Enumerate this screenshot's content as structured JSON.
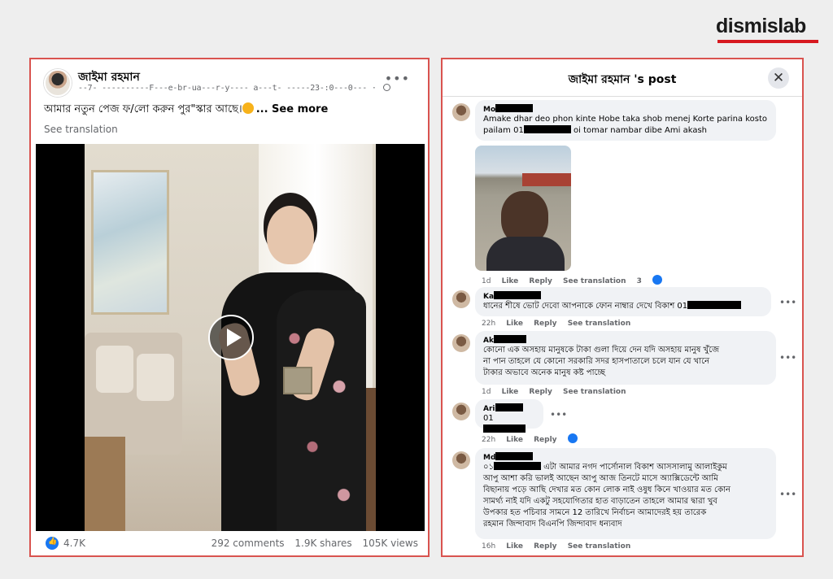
{
  "brand": {
    "logo_text": "dismislab",
    "accent": "#d71920"
  },
  "post": {
    "author": "জাইমা রহমান",
    "meta": "--7- ----------F---e-br-ua---r-y---- a---t- -----23-:0---0--- ·",
    "text": "আমার নতুন পেজ ফ/লো করুন পুর\"স্কার আছে।",
    "see_more": "... See more",
    "see_translation": "See translation",
    "reaction_count": "4.7K",
    "comments": "292 comments",
    "shares": "1.9K shares",
    "views": "105K views",
    "more_icon": "more-dots-icon",
    "play_icon": "play-icon"
  },
  "comments_panel": {
    "title": "জাইমা রহমান 's post",
    "close_label": "✕",
    "comments": [
      {
        "name": "Mo",
        "text_a": "Amake dhar deo phon kinte Hobe taka shob menej Korte parina kosto",
        "text_b": "pailam 01",
        "text_c": " oi tomar nambar dibe Ami akash",
        "time": "1d",
        "like": "Like",
        "reply": "Reply",
        "translation": "See translation",
        "reactions": "3"
      },
      {
        "name": "Ka",
        "text": "ধানের শীষে ভোট দেবো আপনাকে ফোন নাম্বার দেখে বিকাশ 01",
        "time": "22h",
        "like": "Like",
        "reply": "Reply",
        "translation": "See translation"
      },
      {
        "name": "Ak",
        "text_a": "কোনো এক অসহায় মানুষকে টাকা গুলা দিয়ে দেন যদি অসহায় মানুষ খুঁজে",
        "text_b": "না পান তাহলে যে কোনো সরকারি সদর হাসপাতালে চলে যান যে খানে",
        "text_c": "টাকার অভাবে অনেক মানুষ কষ্ট পাচ্ছে",
        "time": "1d",
        "like": "Like",
        "reply": "Reply",
        "translation": "See translation"
      },
      {
        "name": "Ari",
        "text": "01",
        "time": "22h",
        "like": "Like",
        "reply": "Reply"
      },
      {
        "name": "Md",
        "line1_a": "০১",
        "line1_b": " এটা আমার নগদ পার্সোনাল বিকাশ আসসালামু আলাইকুম",
        "line2": "আপু আশা করি ভালই আছেন আপু আজ তিনটে মাসে অ্যাক্সিডেন্টে আমি",
        "line3": "বিছানায় পড়ে আছি দেখার মত কোন লোক নাই ওষুধ কিনে খাওয়ার মত কোন",
        "line4": "সামর্থ্য নাই যদি একটু সহযোগিতার হাত বাড়াতেন তাহলে আমার দ্বারা খুব",
        "line5": "উপকার হত পচিবার সামনে 12 তারিখে নির্বাচন আমাদেরই হয় তারেক",
        "line6": "রহমান জিন্দাবাদ বিএনপি জিন্দাবাদ ধন্যবাদ",
        "time": "16h",
        "like": "Like",
        "reply": "Reply",
        "translation": "See translation"
      }
    ]
  }
}
